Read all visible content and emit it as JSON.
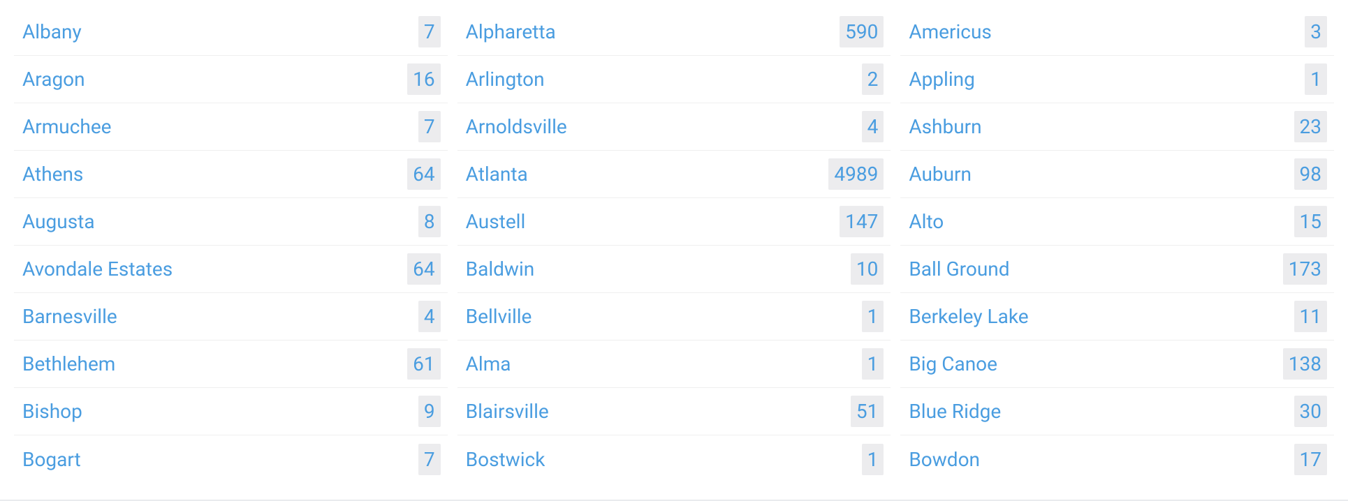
{
  "columns": [
    [
      {
        "name": "Albany",
        "count": 7
      },
      {
        "name": "Aragon",
        "count": 16
      },
      {
        "name": "Armuchee",
        "count": 7
      },
      {
        "name": "Athens",
        "count": 64
      },
      {
        "name": "Augusta",
        "count": 8
      },
      {
        "name": "Avondale Estates",
        "count": 64
      },
      {
        "name": "Barnesville",
        "count": 4
      },
      {
        "name": "Bethlehem",
        "count": 61
      },
      {
        "name": "Bishop",
        "count": 9
      },
      {
        "name": "Bogart",
        "count": 7
      }
    ],
    [
      {
        "name": "Alpharetta",
        "count": 590
      },
      {
        "name": "Arlington",
        "count": 2
      },
      {
        "name": "Arnoldsville",
        "count": 4
      },
      {
        "name": "Atlanta",
        "count": 4989
      },
      {
        "name": "Austell",
        "count": 147
      },
      {
        "name": "Baldwin",
        "count": 10
      },
      {
        "name": "Bellville",
        "count": 1
      },
      {
        "name": "Alma",
        "count": 1
      },
      {
        "name": "Blairsville",
        "count": 51
      },
      {
        "name": "Bostwick",
        "count": 1
      }
    ],
    [
      {
        "name": "Americus",
        "count": 3
      },
      {
        "name": "Appling",
        "count": 1
      },
      {
        "name": "Ashburn",
        "count": 23
      },
      {
        "name": "Auburn",
        "count": 98
      },
      {
        "name": "Alto",
        "count": 15
      },
      {
        "name": "Ball Ground",
        "count": 173
      },
      {
        "name": "Berkeley Lake",
        "count": 11
      },
      {
        "name": "Big Canoe",
        "count": 138
      },
      {
        "name": "Blue Ridge",
        "count": 30
      },
      {
        "name": "Bowdon",
        "count": 17
      }
    ]
  ]
}
